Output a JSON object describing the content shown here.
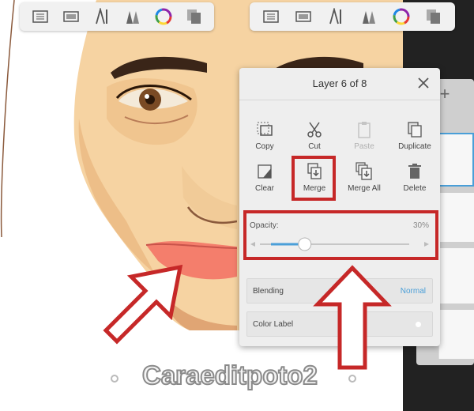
{
  "toolbar_icons": [
    "layers-icon",
    "canvas-icon",
    "ruler-icon",
    "brushes-icon",
    "color-wheel-icon",
    "copy-layers-icon"
  ],
  "panel": {
    "title": "Layer 6 of 8",
    "actions": [
      {
        "label": "Copy",
        "icon": "copy-icon",
        "disabled": false
      },
      {
        "label": "Cut",
        "icon": "scissors-icon",
        "disabled": false
      },
      {
        "label": "Paste",
        "icon": "paste-icon",
        "disabled": true
      },
      {
        "label": "Duplicate",
        "icon": "duplicate-icon",
        "disabled": false
      },
      {
        "label": "Clear",
        "icon": "clear-icon",
        "disabled": false
      },
      {
        "label": "Merge",
        "icon": "merge-icon",
        "disabled": false
      },
      {
        "label": "Merge All",
        "icon": "merge-all-icon",
        "disabled": false
      },
      {
        "label": "Delete",
        "icon": "trash-icon",
        "disabled": false
      }
    ],
    "opacity": {
      "label": "Opacity:",
      "value_text": "30%",
      "value": 0.3
    },
    "blending": {
      "label": "Blending",
      "value": "Normal"
    },
    "color_label": {
      "label": "Color Label"
    }
  },
  "layers_add_symbol": "+",
  "watermark": "Caraeditpoto2",
  "colors": {
    "accent_blue": "#4a9fd8",
    "highlight_red": "#c62828",
    "skin": "#f6d3a2",
    "lips": "#f47e6c"
  }
}
